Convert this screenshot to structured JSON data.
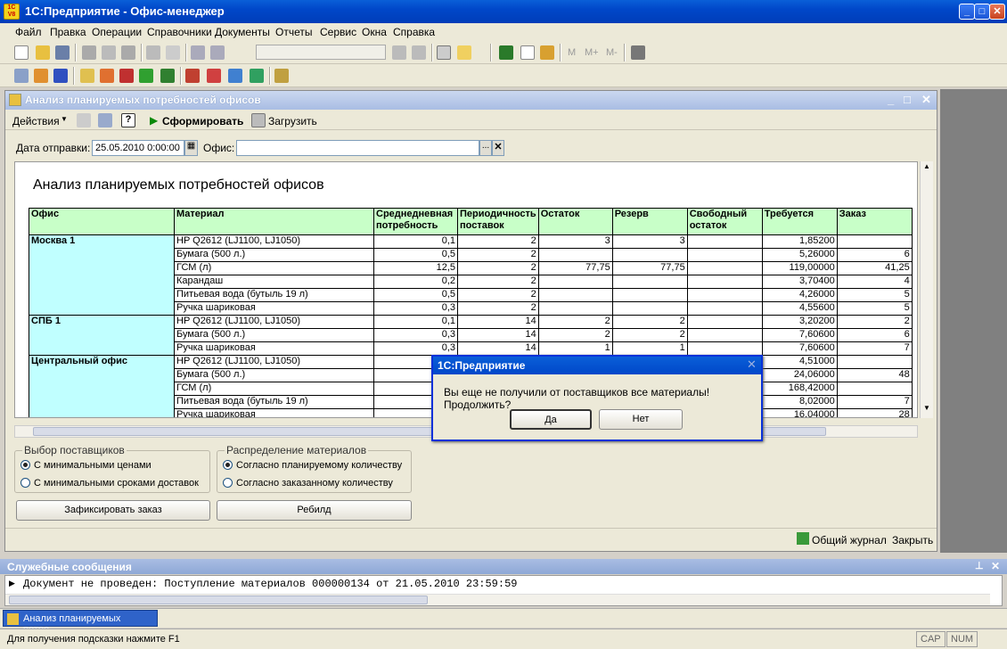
{
  "window_title": "1С:Предприятие - Офис-менеджер",
  "menu": [
    "Файл",
    "Правка",
    "Операции",
    "Справочники",
    "Документы",
    "Отчеты",
    "Сервис",
    "Окна",
    "Справка"
  ],
  "toolbar": {
    "memory_buttons": [
      "M",
      "M+",
      "M-"
    ]
  },
  "doc": {
    "title": "Анализ планируемых потребностей офисов",
    "actions_label": "Действия",
    "generate_label": "Сформировать",
    "load_label": "Загрузить",
    "date_label": "Дата отправки:",
    "date_value": "25.05.2010  0:00:00",
    "office_label": "Офис:",
    "office_value": ""
  },
  "report": {
    "title": "Анализ планируемых потребностей офисов",
    "columns": [
      "Офис",
      "Материал",
      "Среднедневная потребность",
      "Периодичность поставок",
      "Остаток",
      "Резерв",
      "Свободный остаток",
      "Требуется",
      "Заказ"
    ],
    "rows": [
      {
        "office": "Москва 1",
        "material": "HP Q2612 (LJ1100, LJ1050)",
        "avg": "0,1",
        "period": "2",
        "rest": "3",
        "reserve": "3",
        "free": "",
        "need": "1,85200",
        "order": ""
      },
      {
        "office": "",
        "material": "Бумага (500 л.)",
        "avg": "0,5",
        "period": "2",
        "rest": "",
        "reserve": "",
        "free": "",
        "need": "5,26000",
        "order": "6"
      },
      {
        "office": "",
        "material": "ГСМ (л)",
        "avg": "12,5",
        "period": "2",
        "rest": "77,75",
        "reserve": "77,75",
        "free": "",
        "need": "119,00000",
        "order": "41,25"
      },
      {
        "office": "",
        "material": "Карандаш",
        "avg": "0,2",
        "period": "2",
        "rest": "",
        "reserve": "",
        "free": "",
        "need": "3,70400",
        "order": "4"
      },
      {
        "office": "",
        "material": "Питьевая вода (бутыль 19 л)",
        "avg": "0,5",
        "period": "2",
        "rest": "",
        "reserve": "",
        "free": "",
        "need": "4,26000",
        "order": "5"
      },
      {
        "office": "",
        "material": "Ручка шариковая",
        "avg": "0,3",
        "period": "2",
        "rest": "",
        "reserve": "",
        "free": "",
        "need": "4,55600",
        "order": "5"
      },
      {
        "office": "СПБ 1",
        "material": "HP Q2612 (LJ1100, LJ1050)",
        "avg": "0,1",
        "period": "14",
        "rest": "2",
        "reserve": "2",
        "free": "",
        "need": "3,20200",
        "order": "2"
      },
      {
        "office": "",
        "material": "Бумага (500 л.)",
        "avg": "0,3",
        "period": "14",
        "rest": "2",
        "reserve": "2",
        "free": "",
        "need": "7,60600",
        "order": "6"
      },
      {
        "office": "",
        "material": "Ручка шариковая",
        "avg": "0,3",
        "period": "14",
        "rest": "1",
        "reserve": "1",
        "free": "",
        "need": "7,60600",
        "order": "7"
      },
      {
        "office": "Центральный офис",
        "material": "HP Q2612 (LJ1100, LJ1050)",
        "avg": "",
        "period": "",
        "rest": "",
        "reserve": "",
        "free": "",
        "need": "4,51000",
        "order": ""
      },
      {
        "office": "",
        "material": "Бумага (500 л.)",
        "avg": "",
        "period": "",
        "rest": "",
        "reserve": "",
        "free": "",
        "need": "24,06000",
        "order": "48"
      },
      {
        "office": "",
        "material": "ГСМ (л)",
        "avg": "",
        "period": "",
        "rest": "",
        "reserve": "",
        "free": "",
        "need": "168,42000",
        "order": ""
      },
      {
        "office": "",
        "material": "Питьевая вода (бутыль 19 л)",
        "avg": "",
        "period": "",
        "rest": "",
        "reserve": "",
        "free": "",
        "need": "8,02000",
        "order": "7"
      },
      {
        "office": "",
        "material": "Ручка шариковая",
        "avg": "",
        "period": "",
        "rest": "",
        "reserve": "",
        "free": "",
        "need": "16,04000",
        "order": "28"
      }
    ]
  },
  "suppliers": {
    "title": "Выбор поставщиков",
    "opt1": "С минимальными ценами",
    "opt2": "С минимальными сроками доставок"
  },
  "distribution": {
    "title": "Распределение материалов",
    "opt1": "Согласно планируемому количеству",
    "opt2": "Согласно заказанному количеству"
  },
  "buttons": {
    "fix_order": "Зафиксировать заказ",
    "rebuild": "Ребилд",
    "journal": "Общий журнал",
    "close": "Закрыть"
  },
  "dialog": {
    "title": "1С:Предприятие",
    "message": "Вы еще не получили от поставщиков все материалы! Продолжить?",
    "yes": "Да",
    "no": "Нет"
  },
  "messages": {
    "title": "Служебные сообщения",
    "line": "Документ не проведен: Поступление материалов 000000134 от 21.05.2010 23:59:59"
  },
  "taskbar": {
    "item": "Анализ планируемых потре..."
  },
  "status": {
    "hint": "Для получения подсказки нажмите F1",
    "cap": "CAP",
    "num": "NUM"
  }
}
